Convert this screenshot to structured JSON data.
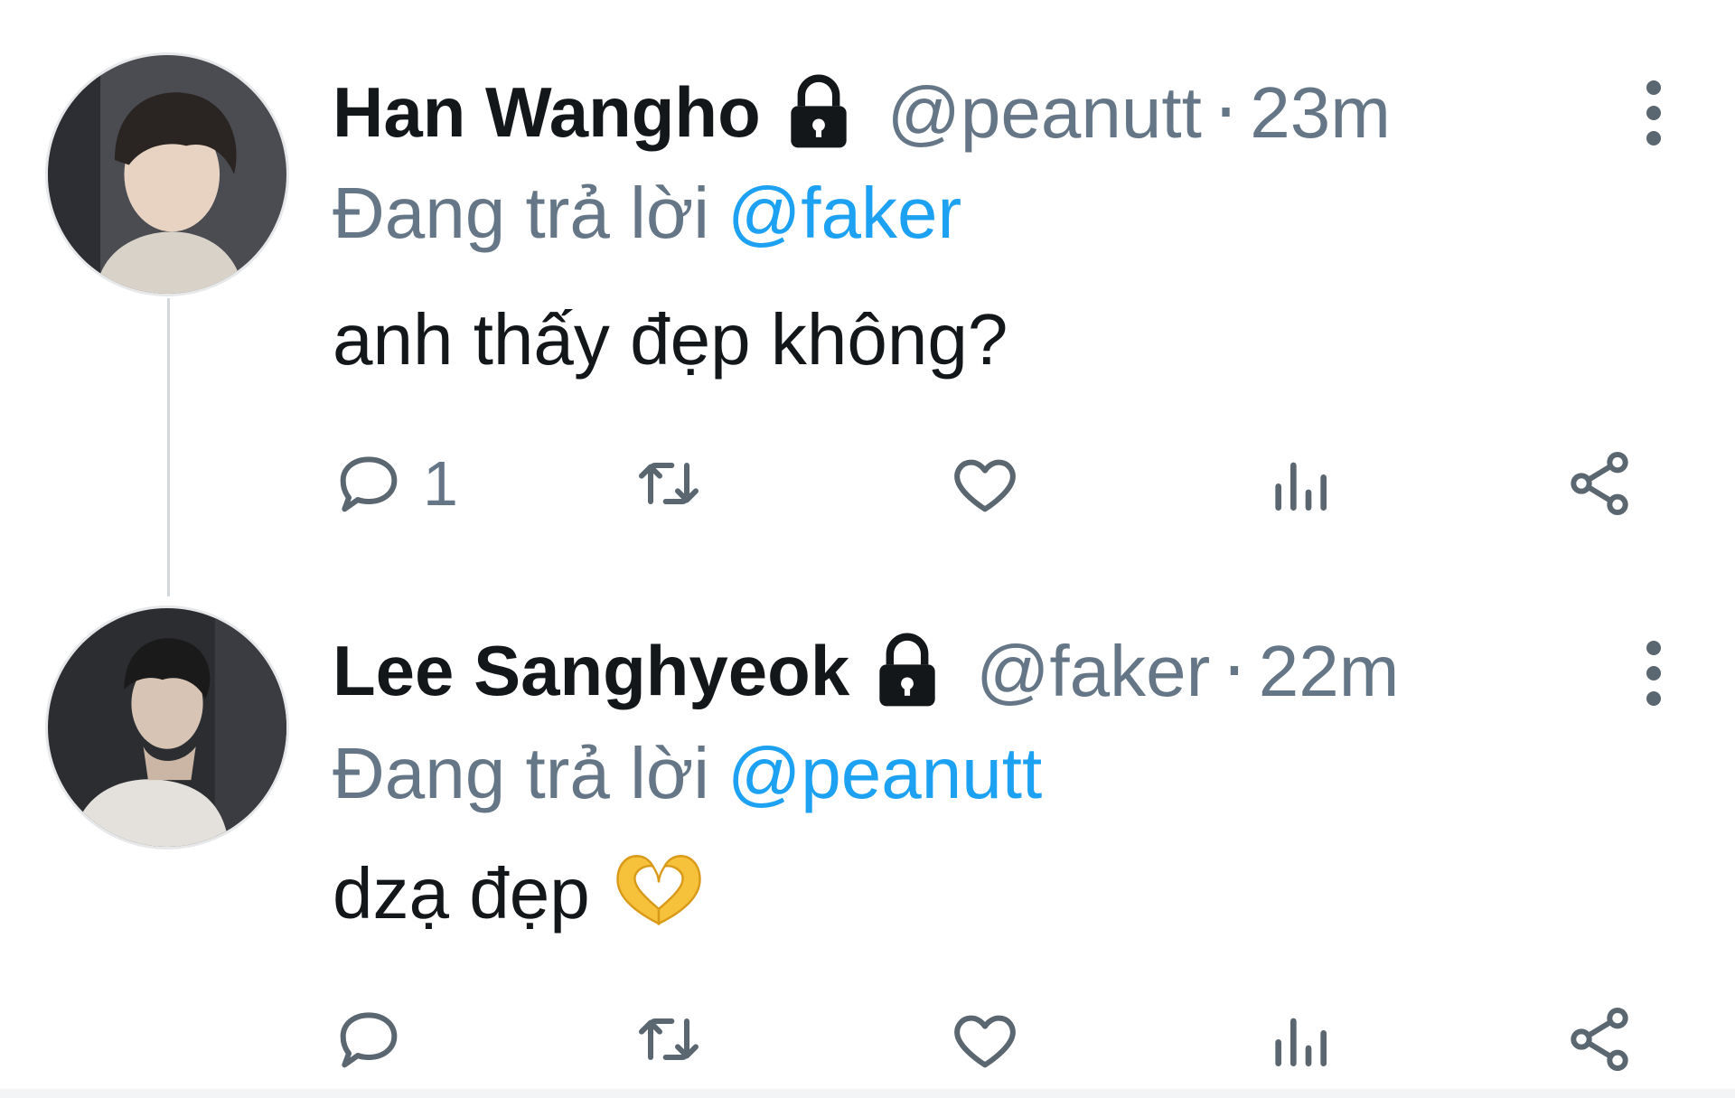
{
  "tweets": [
    {
      "author_name": "Han Wangho",
      "protected": true,
      "handle": "@peanutt",
      "separator": "·",
      "time": "23m",
      "reply_prefix": "Đang trả lời",
      "reply_to": "@faker",
      "text": "anh thấy đẹp không?",
      "emoji": "",
      "reply_count": "1"
    },
    {
      "author_name": "Lee Sanghyeok",
      "protected": true,
      "handle": "@faker",
      "separator": "·",
      "time": "22m",
      "reply_prefix": "Đang trả lời",
      "reply_to": "@peanutt",
      "text": "dzạ đẹp",
      "emoji": "heart-hands",
      "reply_count": ""
    }
  ],
  "icons": [
    "lock-icon",
    "more-icon",
    "reply-icon",
    "retweet-icon",
    "like-icon",
    "stats-icon",
    "share-icon"
  ],
  "colors": {
    "text": "#14171a",
    "muted": "#657786",
    "link": "#1da1f2",
    "icon": "#5b6770"
  }
}
